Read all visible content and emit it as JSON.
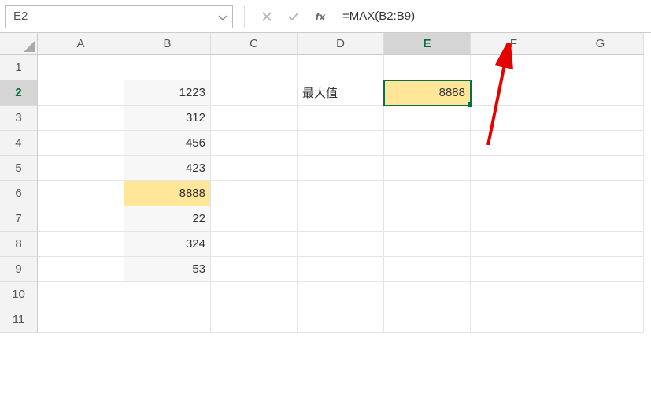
{
  "name_box": {
    "value": "E2"
  },
  "formula_bar": {
    "value": "=MAX(B2:B9)"
  },
  "columns": [
    {
      "label": "A",
      "active": false
    },
    {
      "label": "B",
      "active": false
    },
    {
      "label": "C",
      "active": false
    },
    {
      "label": "D",
      "active": false
    },
    {
      "label": "E",
      "active": true
    },
    {
      "label": "F",
      "active": false
    },
    {
      "label": "G",
      "active": false
    }
  ],
  "rows": [
    {
      "num": "1",
      "active": false
    },
    {
      "num": "2",
      "active": true
    },
    {
      "num": "3",
      "active": false
    },
    {
      "num": "4",
      "active": false
    },
    {
      "num": "5",
      "active": false
    },
    {
      "num": "6",
      "active": false
    },
    {
      "num": "7",
      "active": false
    },
    {
      "num": "8",
      "active": false
    },
    {
      "num": "9",
      "active": false
    },
    {
      "num": "10",
      "active": false
    },
    {
      "num": "11",
      "active": false
    }
  ],
  "cells": {
    "B2": "1223",
    "B3": "312",
    "B4": "456",
    "B5": "423",
    "B6": "8888",
    "B7": "22",
    "B8": "324",
    "B9": "53",
    "D2": "最大值",
    "E2": "8888"
  },
  "highlight_cells": [
    "B6",
    "E2"
  ],
  "selected_cell": "E2",
  "chart_data": {
    "type": "table",
    "description": "Excel worksheet showing MAX function on column B values",
    "column_B_values": [
      1223,
      312,
      456,
      423,
      8888,
      22,
      324,
      53
    ],
    "result_label": "最大值",
    "result_value": 8888,
    "formula": "=MAX(B2:B9)"
  }
}
